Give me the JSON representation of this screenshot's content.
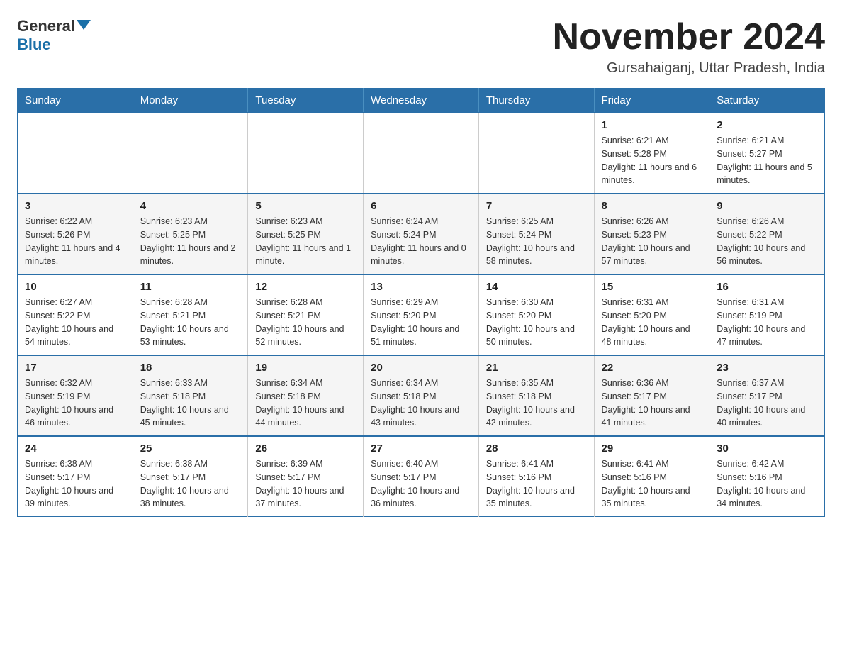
{
  "header": {
    "logo_general": "General",
    "logo_blue": "Blue",
    "title": "November 2024",
    "subtitle": "Gursahaiganj, Uttar Pradesh, India"
  },
  "weekdays": [
    "Sunday",
    "Monday",
    "Tuesday",
    "Wednesday",
    "Thursday",
    "Friday",
    "Saturday"
  ],
  "weeks": [
    [
      {
        "day": "",
        "info": ""
      },
      {
        "day": "",
        "info": ""
      },
      {
        "day": "",
        "info": ""
      },
      {
        "day": "",
        "info": ""
      },
      {
        "day": "",
        "info": ""
      },
      {
        "day": "1",
        "info": "Sunrise: 6:21 AM\nSunset: 5:28 PM\nDaylight: 11 hours and 6 minutes."
      },
      {
        "day": "2",
        "info": "Sunrise: 6:21 AM\nSunset: 5:27 PM\nDaylight: 11 hours and 5 minutes."
      }
    ],
    [
      {
        "day": "3",
        "info": "Sunrise: 6:22 AM\nSunset: 5:26 PM\nDaylight: 11 hours and 4 minutes."
      },
      {
        "day": "4",
        "info": "Sunrise: 6:23 AM\nSunset: 5:25 PM\nDaylight: 11 hours and 2 minutes."
      },
      {
        "day": "5",
        "info": "Sunrise: 6:23 AM\nSunset: 5:25 PM\nDaylight: 11 hours and 1 minute."
      },
      {
        "day": "6",
        "info": "Sunrise: 6:24 AM\nSunset: 5:24 PM\nDaylight: 11 hours and 0 minutes."
      },
      {
        "day": "7",
        "info": "Sunrise: 6:25 AM\nSunset: 5:24 PM\nDaylight: 10 hours and 58 minutes."
      },
      {
        "day": "8",
        "info": "Sunrise: 6:26 AM\nSunset: 5:23 PM\nDaylight: 10 hours and 57 minutes."
      },
      {
        "day": "9",
        "info": "Sunrise: 6:26 AM\nSunset: 5:22 PM\nDaylight: 10 hours and 56 minutes."
      }
    ],
    [
      {
        "day": "10",
        "info": "Sunrise: 6:27 AM\nSunset: 5:22 PM\nDaylight: 10 hours and 54 minutes."
      },
      {
        "day": "11",
        "info": "Sunrise: 6:28 AM\nSunset: 5:21 PM\nDaylight: 10 hours and 53 minutes."
      },
      {
        "day": "12",
        "info": "Sunrise: 6:28 AM\nSunset: 5:21 PM\nDaylight: 10 hours and 52 minutes."
      },
      {
        "day": "13",
        "info": "Sunrise: 6:29 AM\nSunset: 5:20 PM\nDaylight: 10 hours and 51 minutes."
      },
      {
        "day": "14",
        "info": "Sunrise: 6:30 AM\nSunset: 5:20 PM\nDaylight: 10 hours and 50 minutes."
      },
      {
        "day": "15",
        "info": "Sunrise: 6:31 AM\nSunset: 5:20 PM\nDaylight: 10 hours and 48 minutes."
      },
      {
        "day": "16",
        "info": "Sunrise: 6:31 AM\nSunset: 5:19 PM\nDaylight: 10 hours and 47 minutes."
      }
    ],
    [
      {
        "day": "17",
        "info": "Sunrise: 6:32 AM\nSunset: 5:19 PM\nDaylight: 10 hours and 46 minutes."
      },
      {
        "day": "18",
        "info": "Sunrise: 6:33 AM\nSunset: 5:18 PM\nDaylight: 10 hours and 45 minutes."
      },
      {
        "day": "19",
        "info": "Sunrise: 6:34 AM\nSunset: 5:18 PM\nDaylight: 10 hours and 44 minutes."
      },
      {
        "day": "20",
        "info": "Sunrise: 6:34 AM\nSunset: 5:18 PM\nDaylight: 10 hours and 43 minutes."
      },
      {
        "day": "21",
        "info": "Sunrise: 6:35 AM\nSunset: 5:18 PM\nDaylight: 10 hours and 42 minutes."
      },
      {
        "day": "22",
        "info": "Sunrise: 6:36 AM\nSunset: 5:17 PM\nDaylight: 10 hours and 41 minutes."
      },
      {
        "day": "23",
        "info": "Sunrise: 6:37 AM\nSunset: 5:17 PM\nDaylight: 10 hours and 40 minutes."
      }
    ],
    [
      {
        "day": "24",
        "info": "Sunrise: 6:38 AM\nSunset: 5:17 PM\nDaylight: 10 hours and 39 minutes."
      },
      {
        "day": "25",
        "info": "Sunrise: 6:38 AM\nSunset: 5:17 PM\nDaylight: 10 hours and 38 minutes."
      },
      {
        "day": "26",
        "info": "Sunrise: 6:39 AM\nSunset: 5:17 PM\nDaylight: 10 hours and 37 minutes."
      },
      {
        "day": "27",
        "info": "Sunrise: 6:40 AM\nSunset: 5:17 PM\nDaylight: 10 hours and 36 minutes."
      },
      {
        "day": "28",
        "info": "Sunrise: 6:41 AM\nSunset: 5:16 PM\nDaylight: 10 hours and 35 minutes."
      },
      {
        "day": "29",
        "info": "Sunrise: 6:41 AM\nSunset: 5:16 PM\nDaylight: 10 hours and 35 minutes."
      },
      {
        "day": "30",
        "info": "Sunrise: 6:42 AM\nSunset: 5:16 PM\nDaylight: 10 hours and 34 minutes."
      }
    ]
  ]
}
